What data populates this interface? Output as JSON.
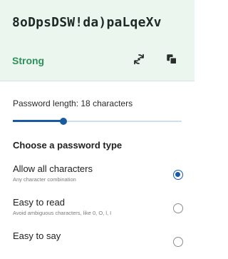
{
  "password": "8oDpsDSW!da)paLqeXv",
  "strength": "Strong",
  "colors": {
    "strong": "#2e8f5a",
    "accent": "#1a5aa0",
    "header_bg": "#ebf6ef"
  },
  "icons": {
    "refresh": "refresh-icon",
    "copy": "copy-icon"
  },
  "length_label": "Password length: 18 characters",
  "length_slider": {
    "value": 18,
    "fraction": 0.3
  },
  "section_title": "Choose a password type",
  "options": [
    {
      "title": "Allow all characters",
      "desc": "Any character combination",
      "selected": true
    },
    {
      "title": "Easy to read",
      "desc": "Avoid ambiguous characters, like 0, O, l, I",
      "selected": false
    },
    {
      "title": "Easy to say",
      "desc": "",
      "selected": false
    }
  ]
}
